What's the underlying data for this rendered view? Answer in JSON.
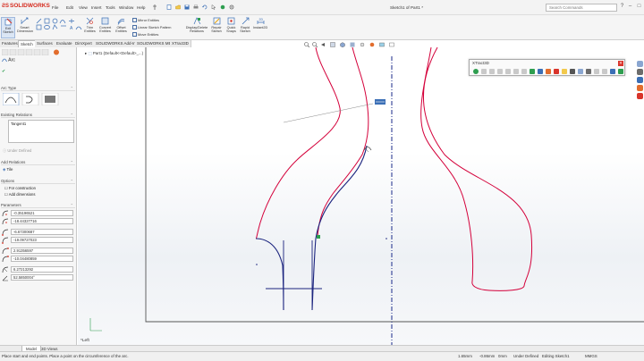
{
  "app": {
    "name": "SOLIDWORKS",
    "document_title": "Sketch1 of Part1 *"
  },
  "menu": [
    "File",
    "Edit",
    "View",
    "Insert",
    "Tools",
    "Window",
    "Help"
  ],
  "search": {
    "placeholder": "Search Commands"
  },
  "command_manager": {
    "large_tools": [
      {
        "label": "Exit Sketch"
      },
      {
        "label": "Smart Dimension"
      },
      {
        "label": "Trim Entities"
      },
      {
        "label": "Convert Entities"
      },
      {
        "label": "Offset Entities"
      },
      {
        "label": "Display/Delete Relations"
      },
      {
        "label": "Repair Sketch"
      },
      {
        "label": "Quick Snaps"
      },
      {
        "label": "Rapid Sketch"
      },
      {
        "label": "Instant2D"
      }
    ],
    "small_tools": [
      "Mirror Entities",
      "Linear Sketch Pattern",
      "Move Entities"
    ]
  },
  "tabs": [
    "Features",
    "Sketch",
    "Surfaces",
    "Evaluate",
    "DimXpert",
    "SOLIDWORKS Add-Ins",
    "SOLIDWORKS MBD",
    "XTract3D"
  ],
  "active_tab": "Sketch",
  "property_manager": {
    "title": "Arc",
    "sections": {
      "arc_type": "Arc Type",
      "existing_relations": "Existing Relations",
      "add_relations": "Add Relations",
      "options": "Options",
      "parameters": "Parameters"
    },
    "existing_relations_item": "Tangent1",
    "under_defined": "Under Defined",
    "add_relations_item": "Tile",
    "options_items": [
      "For construction",
      "Add dimensions"
    ],
    "parameters": [
      "-0.35196521",
      "-18.44327716",
      "-6.67300687",
      "-19.09727023",
      "2.91356597",
      "-10.04480859",
      "6.27213292",
      "52.5850004°"
    ]
  },
  "feature_tree": {
    "item": "Part1 (Default<<Default>_...)"
  },
  "xtract3d": {
    "title": "XTract3D"
  },
  "view_label": "*Left",
  "bottom_tabs": [
    "Model",
    "3D Views"
  ],
  "status": {
    "message": "Place start and end points. Place a point on the circumference of the arc.",
    "x": "1.65mm",
    "y": "-0.86mm",
    "z": "0mm",
    "state": "Under Defined",
    "editing": "Editing Sketch1",
    "units": "MMGS"
  },
  "colors": {
    "accent": "#d52b1e",
    "profile_red": "#d4003a",
    "arc_blue": "#1a237e",
    "centerline": "#1a2a8a"
  }
}
